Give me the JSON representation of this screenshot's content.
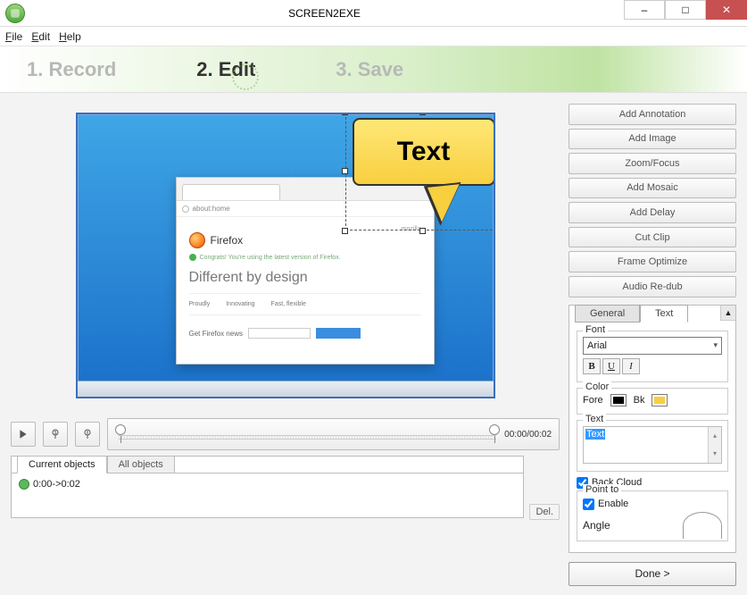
{
  "window": {
    "title": "SCREEN2EXE",
    "controls": {
      "min": "–",
      "max": "□",
      "close": "✕"
    }
  },
  "menu": {
    "file": "File",
    "edit": "Edit",
    "help": "Help"
  },
  "steps": {
    "s1": "1. Record",
    "s2": "2. Edit",
    "s3": "3. Save"
  },
  "preview": {
    "firefox_name": "Firefox",
    "firefox_msg": "Congrats! You're using the latest version of Firefox.",
    "headline": "Different by design",
    "col1": "Proudly",
    "col2": "Innovating",
    "col3": "Fast, flexible",
    "get_label": "Get Firefox news",
    "corner_label": "mozilla"
  },
  "callout": {
    "text": "Text"
  },
  "timeline": {
    "current": "00:00/00:02"
  },
  "controls": {
    "play": "▶",
    "mic_q": "?",
    "mic_e": "!"
  },
  "objects": {
    "tab_current": "Current objects",
    "tab_all": "All objects",
    "item1": "0:00->0:02",
    "del": "Del."
  },
  "right_buttons": {
    "b1": "Add Annotation",
    "b2": "Add Image",
    "b3": "Zoom/Focus",
    "b4": "Add Mosaic",
    "b5": "Add Delay",
    "b6": "Cut Clip",
    "b7": "Frame Optimize",
    "b8": "Audio Re-dub"
  },
  "props": {
    "tab_general": "General",
    "tab_text": "Text",
    "font_legend": "Font",
    "font_value": "Arial",
    "b": "B",
    "u": "U",
    "i": "I",
    "color_legend": "Color",
    "fore": "Fore",
    "bk": "Bk",
    "text_legend": "Text",
    "text_value": "Text",
    "back_cloud": "Back Cloud",
    "point_to": "Point to",
    "enable": "Enable",
    "angle": "Angle"
  },
  "done": "Done  >"
}
